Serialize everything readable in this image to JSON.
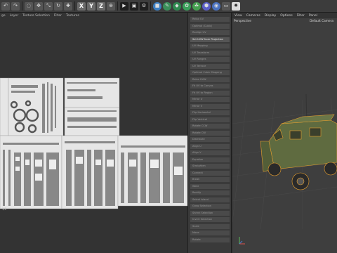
{
  "toolbar": {
    "buttons": [
      "undo-icon",
      "redo-icon",
      "live-selection-icon",
      "move-icon",
      "scale-icon",
      "rotate-icon",
      "last-tool-icon"
    ],
    "axis_labels": [
      "X",
      "Y",
      "Z"
    ],
    "world_label": "⊕",
    "render_buttons": [
      "render-view-icon",
      "render-picture-icon",
      "render-settings-icon"
    ],
    "object_buttons": [
      "cube-icon",
      "pen-icon",
      "subdivision-icon",
      "array-icon",
      "field-icon",
      "deformer-icon",
      "environment-icon",
      "camera-icon",
      "light-icon"
    ]
  },
  "uv_editor": {
    "menu": [
      "ge",
      "Layer",
      "Texture Selection",
      "Filter",
      "Textures"
    ],
    "corner_label": "1/2"
  },
  "uv_commands": {
    "items": [
      "Relax UV",
      "Optimal (Cubic)",
      "Realign UV",
      "Set UVW from Projection",
      "UV Mapping",
      "UV Transform",
      "UV Ranges",
      "UV Terrace",
      "Optimal Cubic Mapping",
      "Relax UVW",
      "Fit UV to Canvas",
      "Fit UV to Region",
      "Mirror U",
      "Mirror V",
      "Flip Horizontal",
      "Flip Vertical",
      "Rotate CCW",
      "Rotate CW",
      "Distribute",
      "Align U",
      "Align V",
      "Equalize",
      "Straighten",
      "Connect",
      "Break",
      "Weld",
      "Rectify",
      "Select Island",
      "Grow Selection",
      "Shrink Selection",
      "Invert Selection",
      "Scale",
      "Move",
      "Rotate"
    ],
    "active_index": 3
  },
  "viewport": {
    "menu": [
      "View",
      "Cameras",
      "Display",
      "Options",
      "Filter",
      "Panel"
    ],
    "projection": "Perspective",
    "camera": "Default Camera"
  },
  "colors": {
    "accent": "#e8a030",
    "vehicle": "#5f6b40",
    "uv_fill": "#e6e6e6"
  }
}
